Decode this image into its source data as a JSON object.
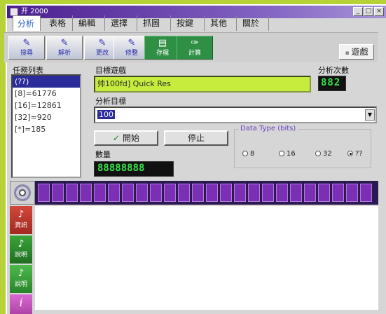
{
  "window": {
    "title": "开 2000"
  },
  "tabs": [
    "分析",
    "表格",
    "編輯",
    "選擇",
    "抓圖",
    "按鍵",
    "其他",
    "關於"
  ],
  "toolbar": {
    "tools": [
      {
        "icon": "search-icon",
        "glyph": "✎",
        "label": "搜尋"
      },
      {
        "icon": "tool-icon",
        "glyph": "✎",
        "label": "解析"
      },
      {
        "icon": "tool-icon",
        "glyph": "✎",
        "label": "更改"
      },
      {
        "icon": "tool-icon",
        "glyph": "✎",
        "label": "修整"
      },
      {
        "icon": "save-icon",
        "glyph": "▤",
        "label": "存檔"
      },
      {
        "icon": "pen-icon",
        "glyph": "✑",
        "label": "計算"
      }
    ],
    "game_button": "遊戲"
  },
  "task_list": {
    "label": "任務列表",
    "items": [
      "(??)",
      "[8]=61776",
      "[16]=12861",
      "[32]=920",
      "[*]=185"
    ]
  },
  "target_game": {
    "label": "目標遊戲",
    "value": "帅100fd] Quick Res"
  },
  "analysis_count": {
    "label": "分析次數",
    "value": "882"
  },
  "analysis_target": {
    "label": "分析目標",
    "value": "100"
  },
  "buttons": {
    "start": "開始",
    "stop": "停止"
  },
  "quantity": {
    "label": "數量",
    "value": "88888888"
  },
  "data_type": {
    "label": "Data Type (bits)",
    "options": [
      "8",
      "16",
      "32",
      "??"
    ],
    "selected": "??"
  },
  "side_buttons": [
    {
      "icon": "note-icon",
      "glyph": "♪",
      "label": "資訊"
    },
    {
      "icon": "note-icon",
      "glyph": "♪",
      "label": "說明"
    },
    {
      "icon": "note-icon",
      "glyph": "♪",
      "label": "說明"
    },
    {
      "icon": "info-icon",
      "glyph": "i",
      "label": ""
    }
  ],
  "colors": {
    "title_bar": "#4b1d90",
    "list_selection": "#2b2b9a",
    "target_game_field": "#c6ec3e",
    "lcd_background": "#111111",
    "lcd_text": "#35e04a",
    "progress_cell": "#7b2fb3",
    "accent_green": "#2f8f45"
  }
}
